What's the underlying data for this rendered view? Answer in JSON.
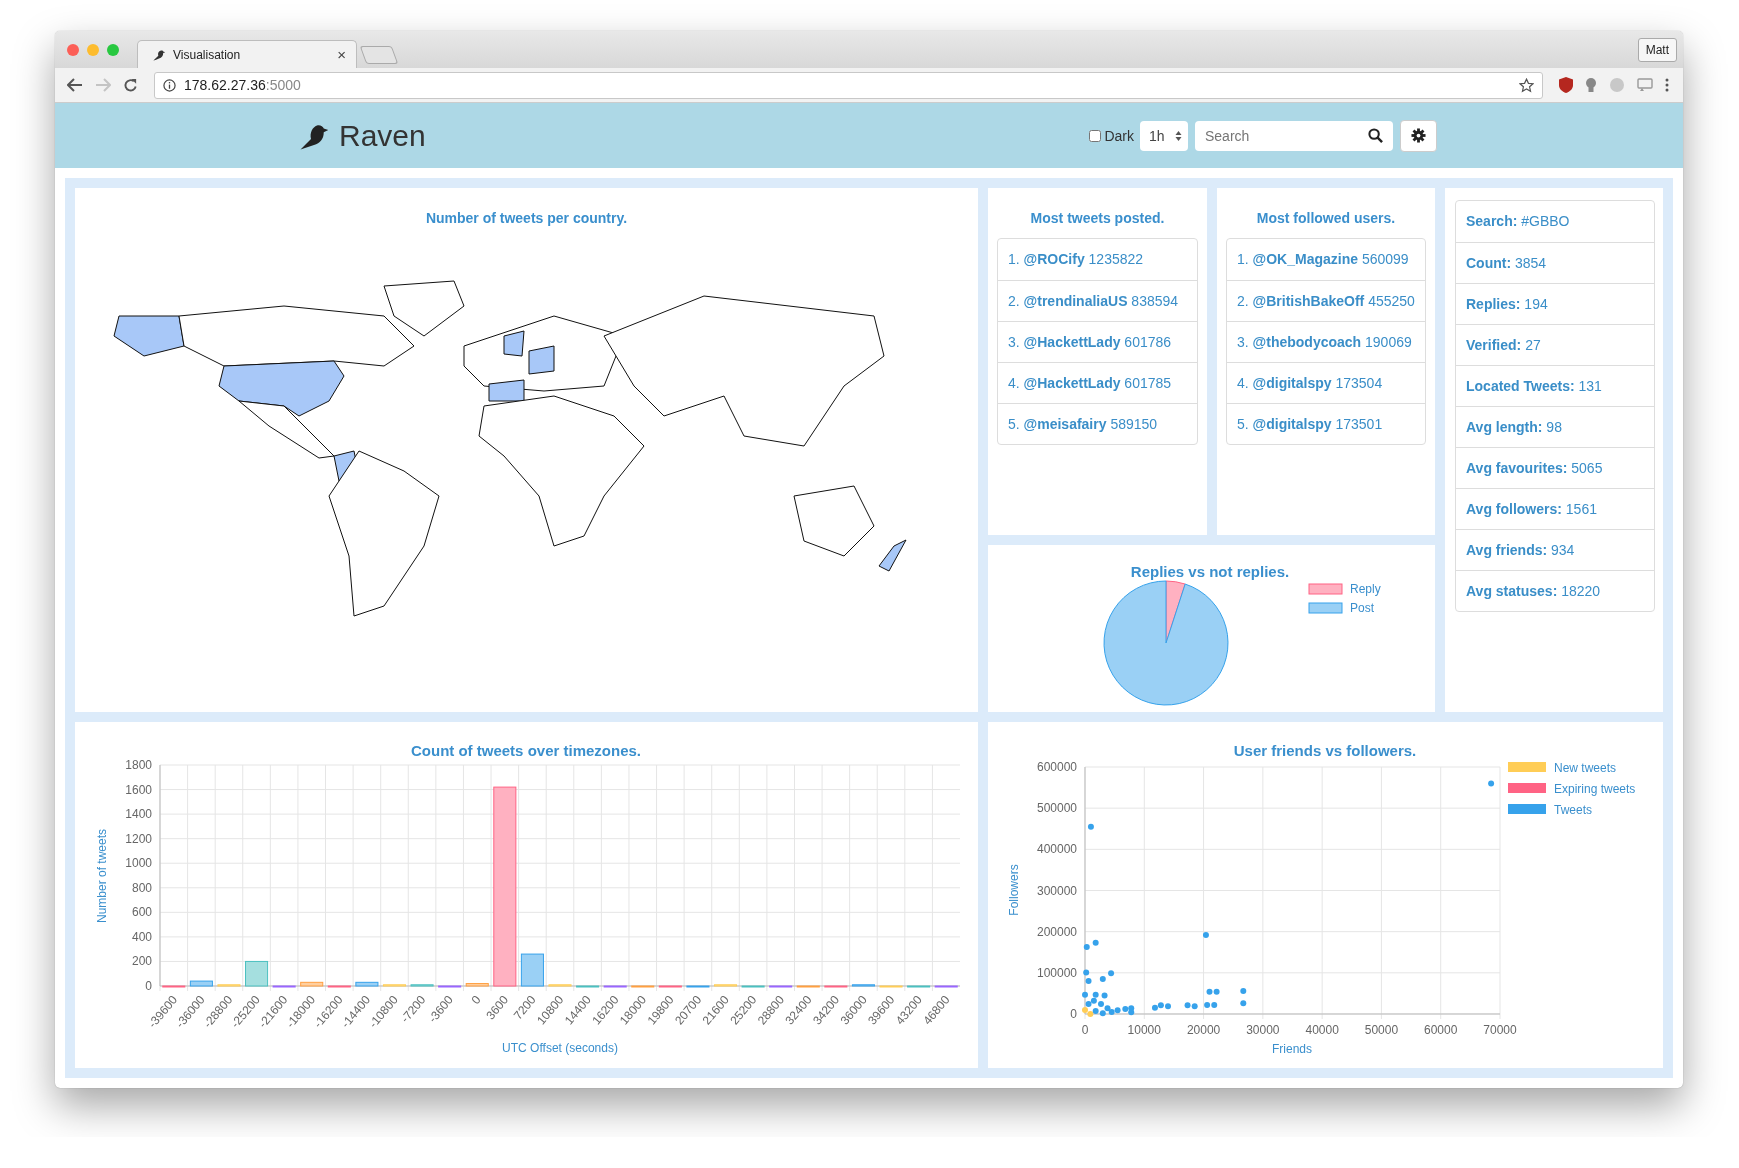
{
  "browser": {
    "tab_title": "Visualisation",
    "tab_close": "×",
    "address": {
      "host": "178.62.27.36",
      "port": ":5000"
    },
    "profile": "Matt"
  },
  "header": {
    "brand": "Raven",
    "dark_toggle": {
      "label": "Dark",
      "checked": false
    },
    "range_select": {
      "value": "1h"
    },
    "search": {
      "placeholder": "Search"
    }
  },
  "map_panel": {
    "title": "Number of tweets per country."
  },
  "most_tweets": {
    "title": "Most tweets posted.",
    "items": [
      "1. **@ROCify** 1235822",
      "2. **@trendinaliaUS** 838594",
      "3. **@HackettLady** 601786",
      "4. **@HackettLady** 601785",
      "5. **@meisafairy** 589150"
    ]
  },
  "most_followed": {
    "title": "Most followed users.",
    "items": [
      "1. **@OK_Magazine** 560099",
      "2. **@BritishBakeOff** 455250",
      "3. **@thebodycoach** 190069",
      "4. **@digitalspy** 173504",
      "5. **@digitalspy** 173501"
    ]
  },
  "stats": [
    "**Search:** #GBBO",
    "**Count:** 3854",
    "**Replies:** 194",
    "**Verified:** 27",
    "**Located Tweets:** 131",
    "**Avg length:** 98",
    "**Avg favourites:** 5065",
    "**Avg followers:** 1561",
    "**Avg friends:** 934",
    "**Avg statuses:** 18220"
  ],
  "replies_panel": {
    "chart_data": {
      "type": "pie",
      "title": "Replies vs not replies.",
      "categories": [
        "Reply",
        "Post"
      ],
      "values": [
        5,
        95
      ],
      "legend": "right"
    }
  },
  "timezone_panel": {
    "chart_data": {
      "type": "bar",
      "title": "Count of tweets over timezones.",
      "xlabel": "UTC Offset (seconds)",
      "ylabel": "Number of tweets",
      "grid": true,
      "categories": [
        "-39600",
        "-36000",
        "-28800",
        "-25200",
        "-21600",
        "-18000",
        "-16200",
        "-14400",
        "-10800",
        "-7200",
        "-3600",
        "0",
        "3600",
        "7200",
        "10800",
        "14400",
        "16200",
        "18000",
        "19800",
        "20700",
        "21600",
        "25200",
        "28800",
        "32400",
        "34200",
        "36000",
        "39600",
        "43200",
        "46800"
      ],
      "values": [
        0,
        40,
        10,
        200,
        0,
        30,
        0,
        30,
        10,
        10,
        0,
        20,
        1620,
        260,
        10,
        0,
        0,
        0,
        0,
        0,
        10,
        0,
        0,
        0,
        0,
        10,
        0,
        0,
        0
      ],
      "ylim": [
        0,
        1800
      ],
      "yticks": [
        0,
        200,
        400,
        600,
        800,
        1000,
        1200,
        1400,
        1600,
        1800
      ]
    }
  },
  "friends_panel": {
    "chart_data": {
      "type": "scatter",
      "title": "User friends vs followers.",
      "xlabel": "Friends",
      "ylabel": "Followers",
      "grid": true,
      "legend": "right",
      "xlim": [
        0,
        70000
      ],
      "ylim": [
        0,
        600000
      ],
      "xticks": [
        0,
        10000,
        20000,
        30000,
        40000,
        50000,
        60000,
        70000
      ],
      "yticks": [
        0,
        100000,
        200000,
        300000,
        400000,
        500000,
        600000
      ],
      "series": [
        {
          "name": "New tweets",
          "color": "#ffcd56",
          "x": [
            0,
            900
          ],
          "values": [
            10000,
            0
          ]
        },
        {
          "name": "Expiring tweets",
          "color": "#ff6384"
        },
        {
          "name": "Tweets",
          "color": "#36a2eb",
          "x": [
            68500,
            1000,
            20400,
            1800,
            300,
            200,
            4400,
            3000,
            600,
            26700,
            21000,
            22200,
            3300,
            1800,
            0,
            26700,
            21800,
            20600,
            18500,
            17300,
            14000,
            12800,
            11800,
            7800,
            6800,
            5500,
            4500,
            3800,
            2700,
            1500,
            600,
            3000,
            1800,
            7800
          ],
          "values": [
            560000,
            455000,
            192000,
            173000,
            163000,
            101000,
            99000,
            85000,
            80000,
            56000,
            54000,
            54000,
            45000,
            47000,
            47000,
            26000,
            22000,
            22000,
            19000,
            21000,
            19000,
            21000,
            15000,
            14000,
            12000,
            9000,
            5000,
            14000,
            24000,
            32000,
            24000,
            2000,
            7000,
            4000
          ]
        }
      ]
    }
  }
}
